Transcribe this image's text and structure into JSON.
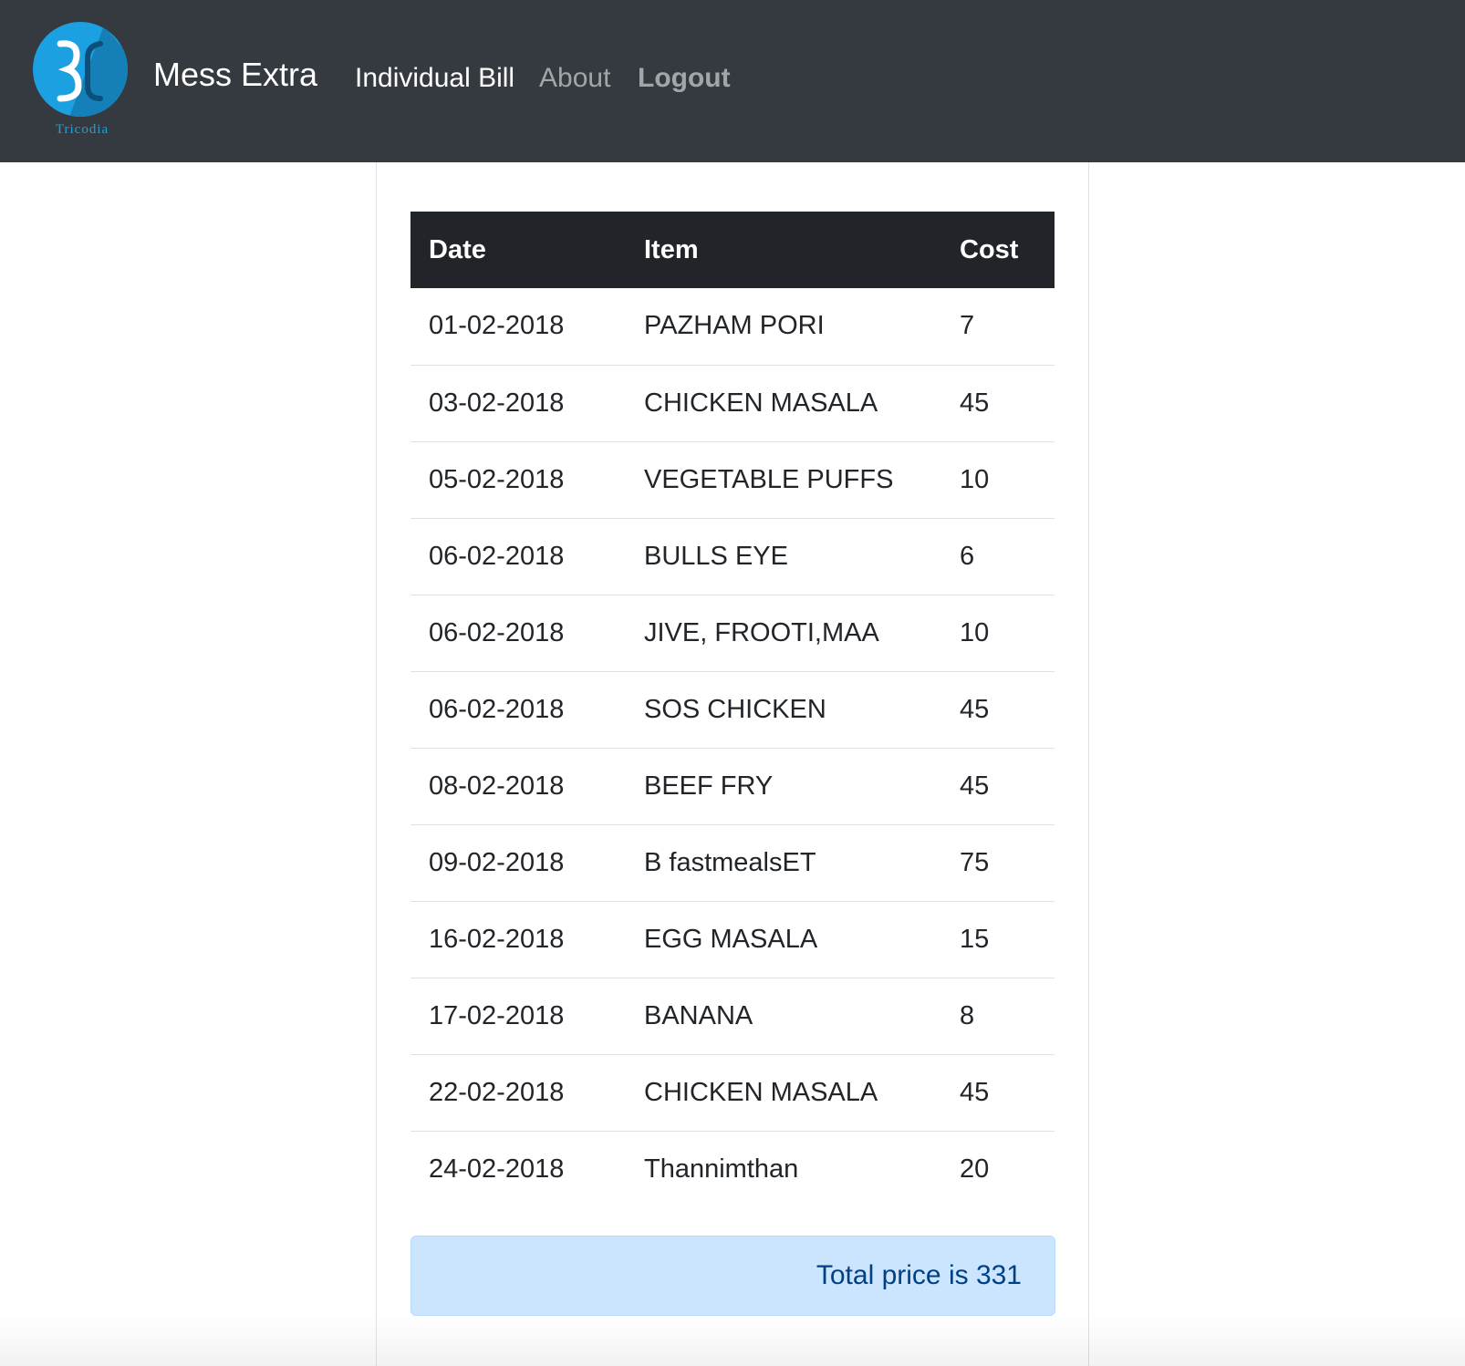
{
  "navbar": {
    "logo_caption": "Tricodia",
    "brand": "Mess Extra",
    "links": {
      "individual_bill": "Individual Bill",
      "about": "About",
      "logout": "Logout"
    }
  },
  "table": {
    "headers": {
      "date": "Date",
      "item": "Item",
      "cost": "Cost"
    },
    "rows": [
      {
        "date": "01-02-2018",
        "item": "PAZHAM PORI",
        "cost": "7"
      },
      {
        "date": "03-02-2018",
        "item": "CHICKEN MASALA",
        "cost": "45"
      },
      {
        "date": "05-02-2018",
        "item": "VEGETABLE PUFFS",
        "cost": "10"
      },
      {
        "date": "06-02-2018",
        "item": "BULLS EYE",
        "cost": "6"
      },
      {
        "date": "06-02-2018",
        "item": "JIVE, FROOTI,MAA",
        "cost": "10"
      },
      {
        "date": "06-02-2018",
        "item": "SOS CHICKEN",
        "cost": "45"
      },
      {
        "date": "08-02-2018",
        "item": "BEEF FRY",
        "cost": "45"
      },
      {
        "date": "09-02-2018",
        "item": "B fastmealsET",
        "cost": "75"
      },
      {
        "date": "16-02-2018",
        "item": "EGG MASALA",
        "cost": "15"
      },
      {
        "date": "17-02-2018",
        "item": "BANANA",
        "cost": "8"
      },
      {
        "date": "22-02-2018",
        "item": "CHICKEN MASALA",
        "cost": "45"
      },
      {
        "date": "24-02-2018",
        "item": "Thannimthan",
        "cost": "20"
      }
    ]
  },
  "total": {
    "text": "Total price is 331"
  },
  "colors": {
    "navbar_bg": "#343a40",
    "table_header_bg": "#212529",
    "alert_bg": "#cce5ff",
    "alert_text": "#004085",
    "logo_circle": "#1ba1e2"
  },
  "icons": {
    "logo": "tricodia-logo-icon"
  }
}
